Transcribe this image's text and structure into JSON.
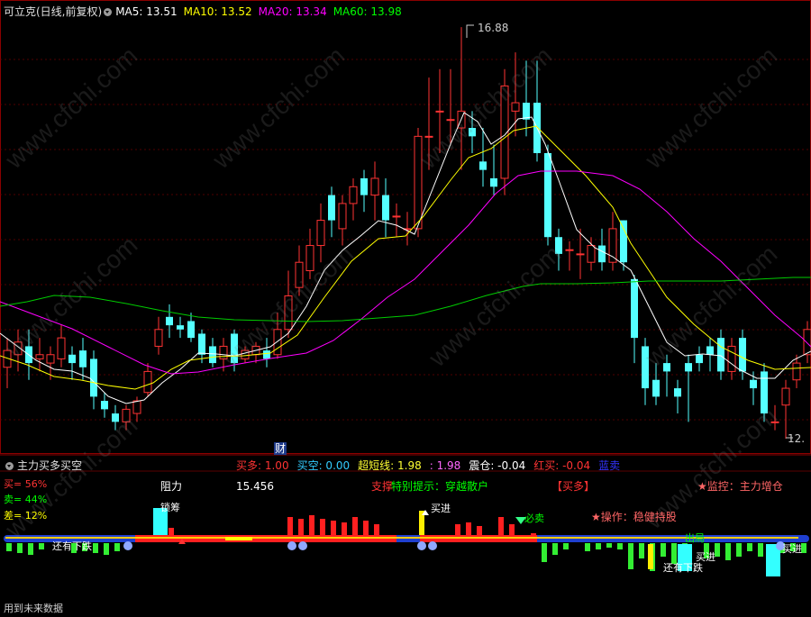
{
  "header": {
    "title": "可立克(日线,前复权)",
    "ma": [
      {
        "label": "MA5: 13.51",
        "color": "#ffffff"
      },
      {
        "label": "MA10: 13.52",
        "color": "#ffff00"
      },
      {
        "label": "MA20: 13.34",
        "color": "#ff00ff"
      },
      {
        "label": "MA60: 13.98",
        "color": "#00ff00"
      }
    ]
  },
  "price_labels": {
    "high": "16.88",
    "low": "12.",
    "finance_marker": "财"
  },
  "indicator": {
    "title": "主力买多买空",
    "values": [
      {
        "label": "买多: 1.00",
        "color": "#ff3333"
      },
      {
        "label": "买空: 0.00",
        "color": "#33ccff"
      },
      {
        "label": "超短线: 1.98",
        "color": "#ffff33"
      },
      {
        "label": ": 1.98",
        "color": "#ff66ff"
      },
      {
        "label": "震仓: -0.04",
        "color": "#ffffff"
      },
      {
        "label": "红买: -0.04",
        "color": "#ff3333"
      },
      {
        "label": "蓝卖",
        "color": "#3333ff"
      }
    ],
    "buy_pct": "买= 56%",
    "sell_pct": "卖= 44%",
    "diff_pct": "差= 12%",
    "resistance_label": "阻力",
    "resistance_value": "15.456",
    "special_tip_prefix": "支撑",
    "special_tip": "特别提示：穿越散户",
    "signal_buy_more": "【买多】",
    "monitor": "★监控：主力增仓",
    "operation": "★操作：稳健持股",
    "tag_lock": "锁筹",
    "tag_buy_in": "买进",
    "tag_must_sell": "必卖",
    "tag_still_fall": "还有下跌",
    "tag_buy_in2": "买进",
    "tag_still_fall2": "还有下跌",
    "tag_out": "出局",
    "tag_buy_sell": "买进",
    "footer": "用到未来数据"
  },
  "watermark": "www.cfchi.com",
  "chart_data": {
    "type": "candlestick",
    "series_names": [
      "MA5",
      "MA10",
      "MA20",
      "MA60"
    ],
    "high": 16.88,
    "low": 12.0,
    "indicator_values": {
      "买多": 1.0,
      "买空": 0.0,
      "超短线": 1.98,
      "震仓": -0.04,
      "红买": -0.04
    },
    "percentages": {
      "买": 56,
      "卖": 44,
      "差": 12
    }
  }
}
